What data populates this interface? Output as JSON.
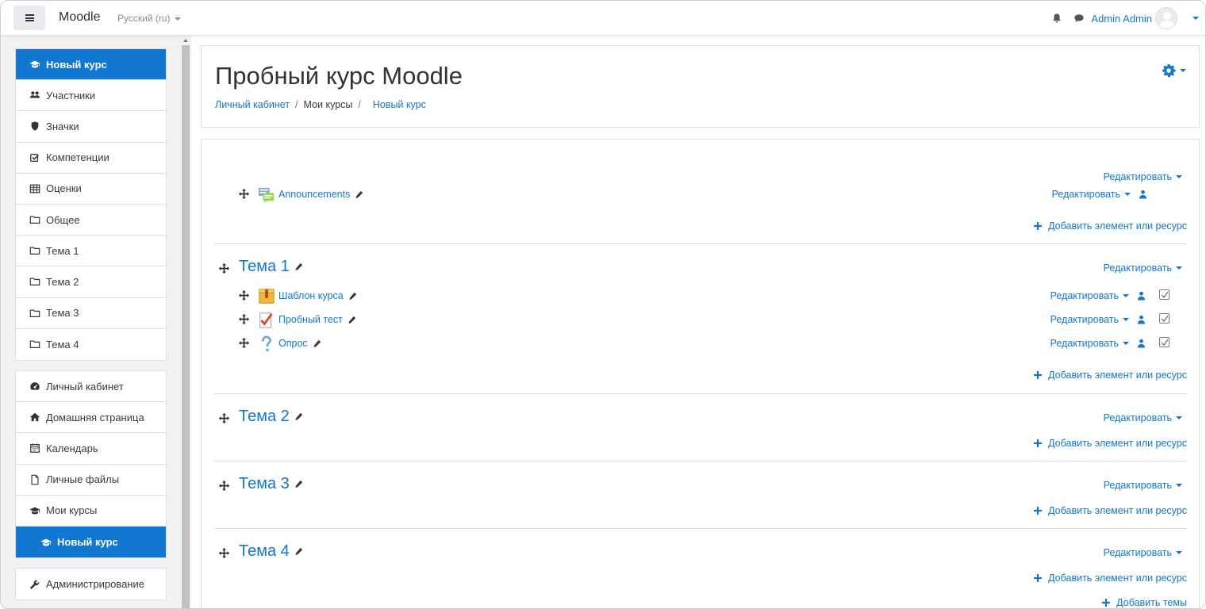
{
  "navbar": {
    "brand": "Moodle",
    "language": "Русский (ru)",
    "user_name": "Admin Admin"
  },
  "sidebar": {
    "course_items": [
      {
        "label": "Новый курс",
        "icon": "graduation-cap-icon",
        "active": true
      },
      {
        "label": "Участники",
        "icon": "users-icon"
      },
      {
        "label": "Значки",
        "icon": "shield-icon"
      },
      {
        "label": "Компетенции",
        "icon": "check-square-icon"
      },
      {
        "label": "Оценки",
        "icon": "table-icon"
      },
      {
        "label": "Общее",
        "icon": "folder-icon"
      },
      {
        "label": "Тема 1",
        "icon": "folder-icon"
      },
      {
        "label": "Тема 2",
        "icon": "folder-icon"
      },
      {
        "label": "Тема 3",
        "icon": "folder-icon"
      },
      {
        "label": "Тема 4",
        "icon": "folder-icon"
      }
    ],
    "site_items": [
      {
        "label": "Личный кабинет",
        "icon": "dashboard-icon"
      },
      {
        "label": "Домашняя страница",
        "icon": "home-icon"
      },
      {
        "label": "Календарь",
        "icon": "calendar-icon"
      },
      {
        "label": "Личные файлы",
        "icon": "file-icon"
      },
      {
        "label": "Мои курсы",
        "icon": "graduation-cap-icon"
      },
      {
        "label": "Новый курс",
        "icon": "graduation-cap-icon",
        "active": true
      }
    ],
    "admin_item": {
      "label": "Администрирование",
      "icon": "wrench-icon"
    }
  },
  "header": {
    "title": "Пробный курс Moodle",
    "breadcrumb": [
      "Личный кабинет",
      "Мои курсы",
      "Новый курс"
    ]
  },
  "course": {
    "edit_label": "Редактировать",
    "add_activity_label": "Добавить элемент или ресурс",
    "add_topics_label": "Добавить темы",
    "general_activity": {
      "name": "Announcements",
      "icon": "forum-icon"
    },
    "sections": [
      {
        "title": "Тема 1",
        "activities": [
          {
            "name": "Шаблон курса",
            "icon": "package-icon"
          },
          {
            "name": "Пробный тест",
            "icon": "quiz-icon"
          },
          {
            "name": "Опрос",
            "icon": "question-icon"
          }
        ]
      },
      {
        "title": "Тема 2",
        "activities": []
      },
      {
        "title": "Тема 3",
        "activities": []
      },
      {
        "title": "Тема 4",
        "activities": []
      }
    ]
  },
  "colors": {
    "accent": "#1177d1",
    "drawer_bg": "#f2f2f2"
  }
}
